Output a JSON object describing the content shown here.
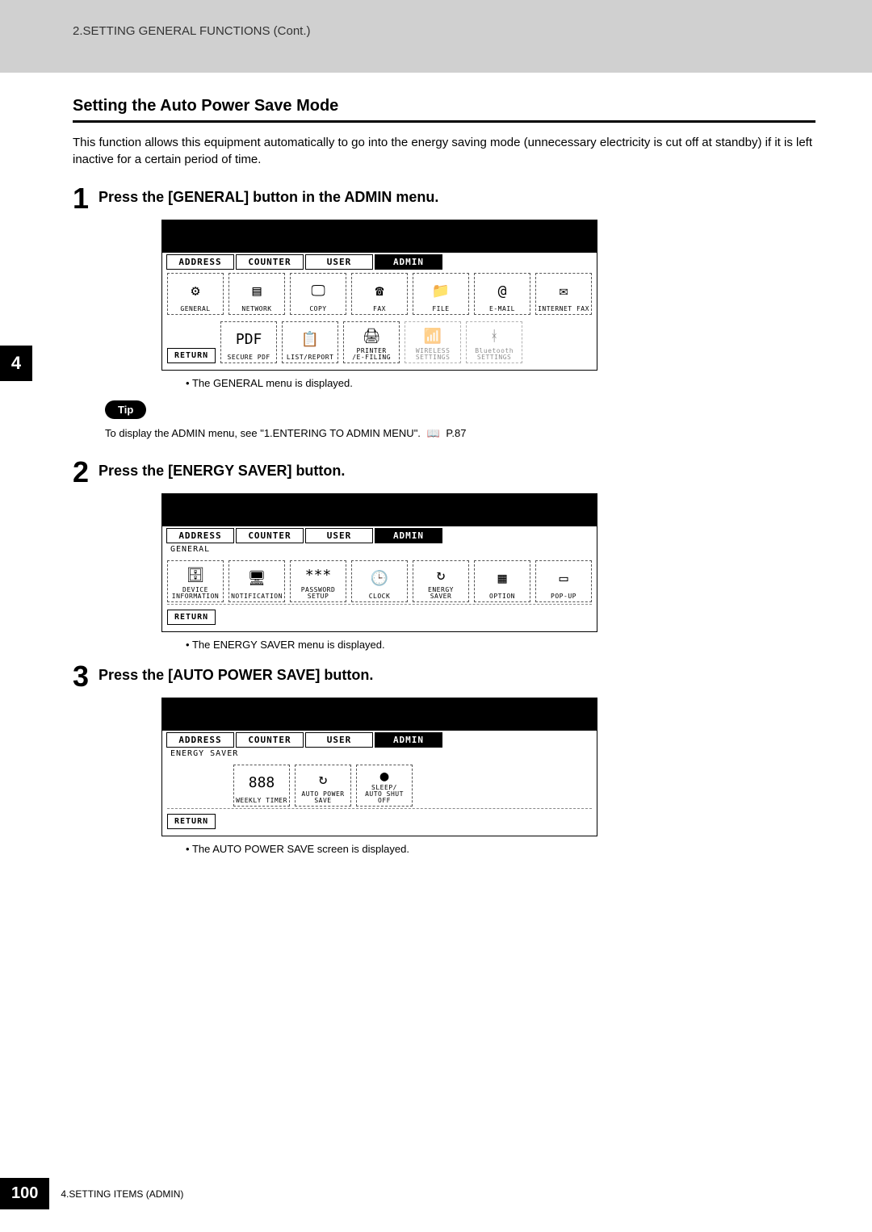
{
  "breadcrumb": "2.SETTING GENERAL FUNCTIONS (Cont.)",
  "section_title": "Setting the Auto Power Save Mode",
  "intro": "This function allows this equipment automatically to go into the energy saving mode (unnecessary electricity is cut off at standby) if it is left inactive for a certain period of time.",
  "side_tab": "4",
  "tip_label": "Tip",
  "tip_text_prefix": "To display the ADMIN menu, see \"1.ENTERING TO ADMIN MENU\".",
  "tip_page_ref": "P.87",
  "steps": [
    {
      "num": "1",
      "title": "Press the [GENERAL] button in the ADMIN menu.",
      "note": "The GENERAL menu is displayed."
    },
    {
      "num": "2",
      "title": "Press the [ENERGY SAVER] button.",
      "note": "The ENERGY SAVER menu is displayed."
    },
    {
      "num": "3",
      "title": "Press the [AUTO POWER SAVE] button.",
      "note": "The AUTO POWER SAVE screen is displayed."
    }
  ],
  "tabs": {
    "address": "ADDRESS",
    "counter": "COUNTER",
    "user": "USER",
    "admin": "ADMIN"
  },
  "paths": {
    "general": "GENERAL",
    "energy_saver": "ENERGY SAVER"
  },
  "return_label": "RETURN",
  "panel1": {
    "row1": [
      {
        "label": "GENERAL",
        "glyph": "⚙"
      },
      {
        "label": "NETWORK",
        "glyph": "▤"
      },
      {
        "label": "COPY",
        "glyph": "🖵"
      },
      {
        "label": "FAX",
        "glyph": "☎"
      },
      {
        "label": "FILE",
        "glyph": "📁"
      },
      {
        "label": "E-MAIL",
        "glyph": "@"
      },
      {
        "label": "INTERNET FAX",
        "glyph": "✉"
      }
    ],
    "row2": [
      {
        "label": "SECURE PDF",
        "glyph": "PDF"
      },
      {
        "label": "LIST/REPORT",
        "glyph": "📋"
      },
      {
        "label": "PRINTER\n/E-FILING",
        "glyph": "🖨"
      },
      {
        "label": "WIRELESS\nSETTINGS",
        "glyph": "📶",
        "disabled": true
      },
      {
        "label": "Bluetooth\nSETTINGS",
        "glyph": "ᚼ",
        "disabled": true
      }
    ]
  },
  "panel2": {
    "row1": [
      {
        "label": "DEVICE\nINFORMATION",
        "glyph": "🗄"
      },
      {
        "label": "NOTIFICATION",
        "glyph": "🖥"
      },
      {
        "label": "PASSWORD SETUP",
        "glyph": "***"
      },
      {
        "label": "CLOCK",
        "glyph": "🕒"
      },
      {
        "label": "ENERGY\nSAVER",
        "glyph": "↻"
      },
      {
        "label": "OPTION",
        "glyph": "▦"
      },
      {
        "label": "POP-UP",
        "glyph": "▭"
      }
    ]
  },
  "panel3": {
    "row1": [
      {
        "label": "WEEKLY TIMER",
        "glyph": "888"
      },
      {
        "label": "AUTO POWER\nSAVE",
        "glyph": "↻"
      },
      {
        "label": "SLEEP/\nAUTO SHUT OFF",
        "glyph": "●"
      }
    ]
  },
  "footer": {
    "page_num": "100",
    "text": "4.SETTING ITEMS (ADMIN)"
  }
}
